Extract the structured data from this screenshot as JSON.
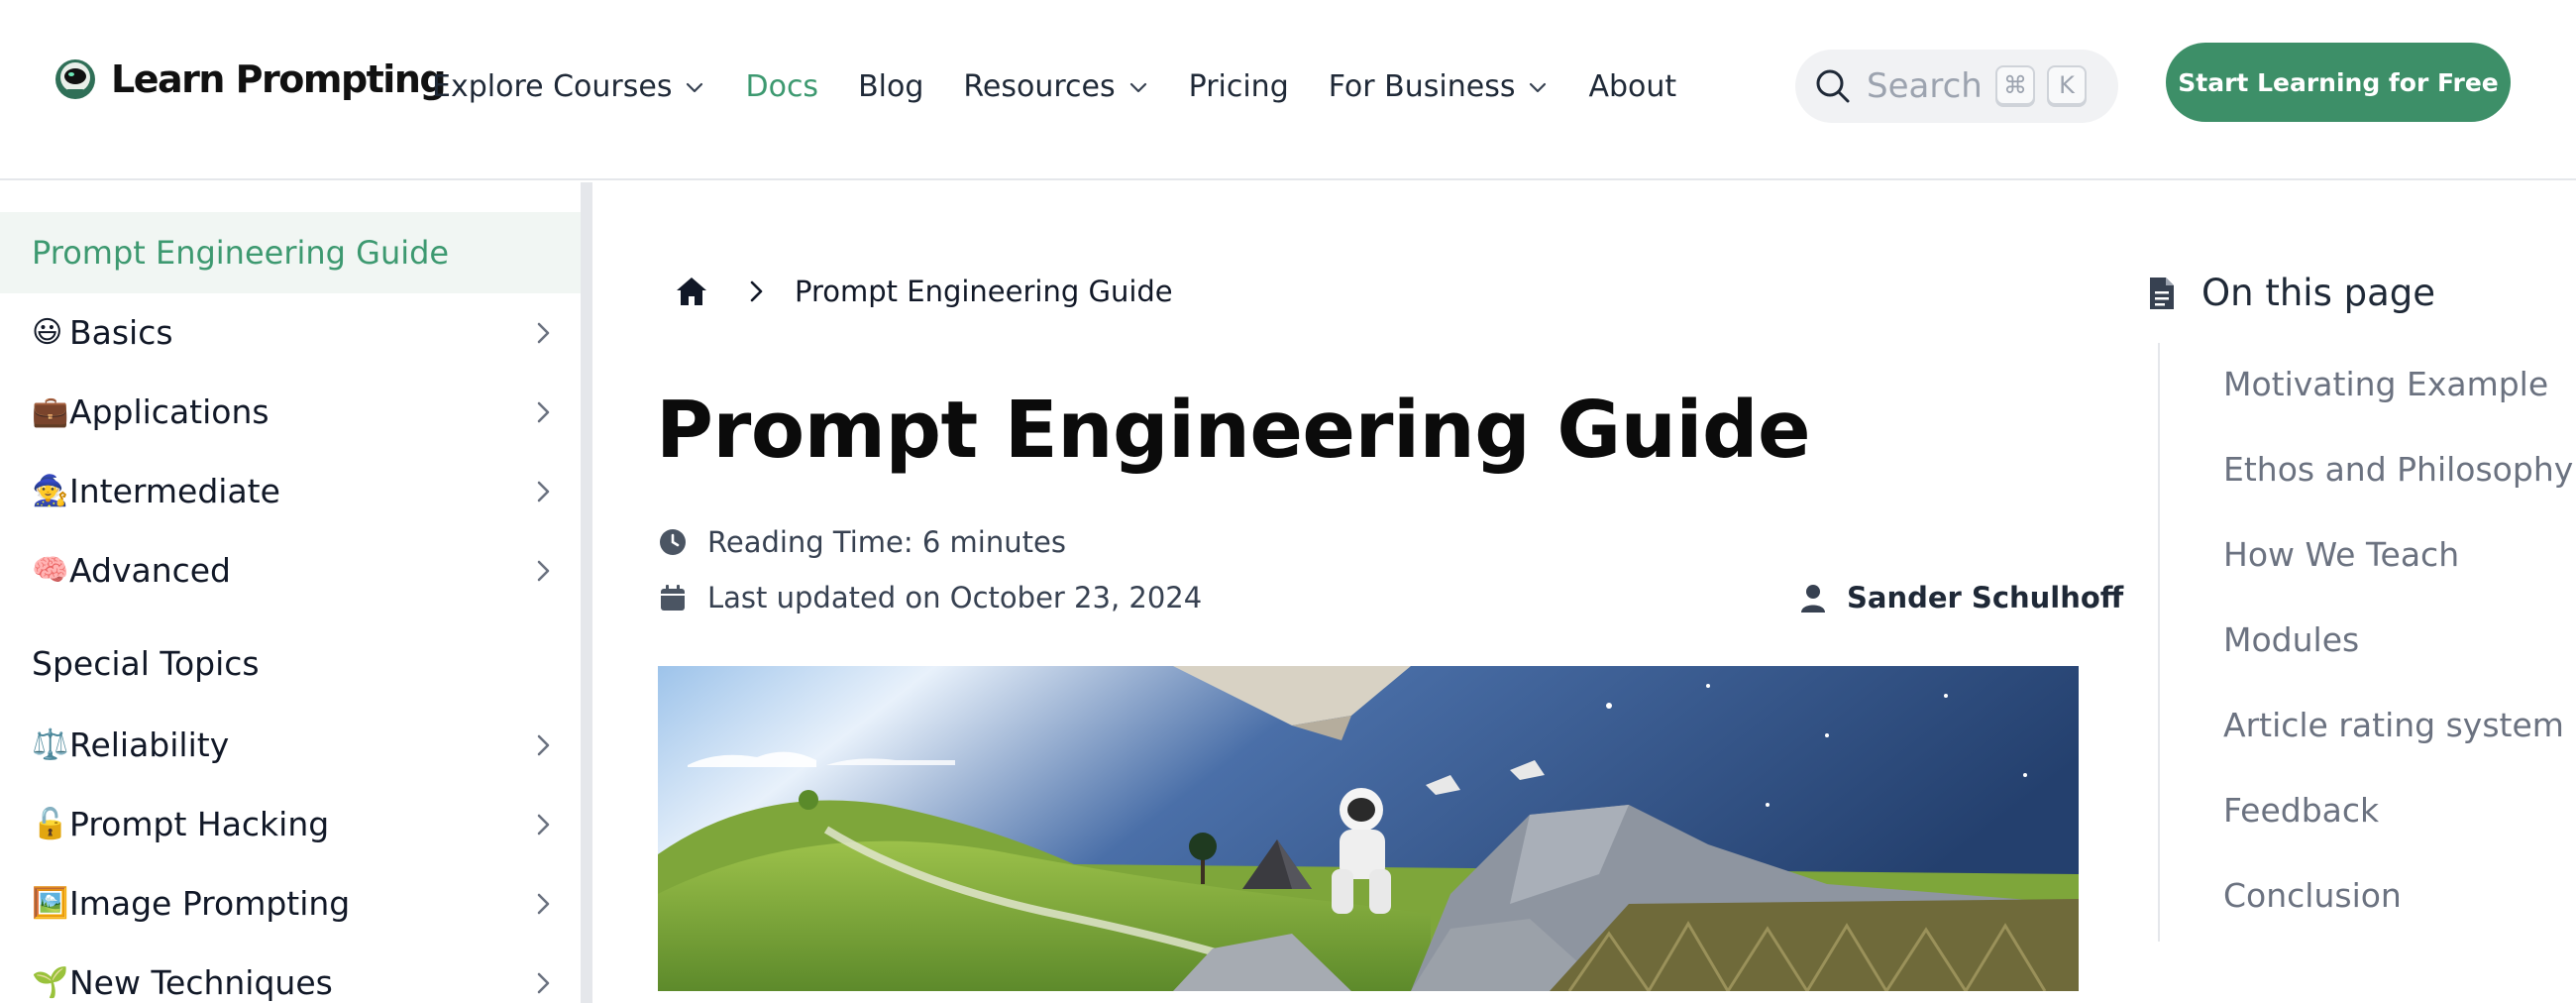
{
  "header": {
    "logo_text": "Learn Prompting",
    "nav": [
      {
        "label": "Explore Courses",
        "dropdown": true
      },
      {
        "label": "Docs",
        "active": true
      },
      {
        "label": "Blog"
      },
      {
        "label": "Resources",
        "dropdown": true
      },
      {
        "label": "Pricing"
      },
      {
        "label": "For Business",
        "dropdown": true
      },
      {
        "label": "About"
      }
    ],
    "search_placeholder": "Search",
    "search_kbd_1": "⌘",
    "search_kbd_2": "K",
    "cta_label": "Start Learning for Free"
  },
  "sidebar": {
    "active_label": "Prompt Engineering Guide",
    "items": [
      {
        "emoji": "😃",
        "label": "Basics"
      },
      {
        "emoji": "💼",
        "label": "Applications"
      },
      {
        "emoji": "🧙",
        "label": "Intermediate"
      },
      {
        "emoji": "🧠",
        "label": "Advanced"
      }
    ],
    "section_heading": "Special Topics",
    "topic_items": [
      {
        "emoji": "⚖️",
        "label": "Reliability"
      },
      {
        "emoji": "🔓",
        "label": "Prompt Hacking"
      },
      {
        "emoji": "🖼️",
        "label": "Image Prompting"
      },
      {
        "emoji": "🌱",
        "label": "New Techniques"
      }
    ]
  },
  "main": {
    "breadcrumb_label": "Prompt Engineering Guide",
    "title": "Prompt Engineering Guide",
    "reading_time": "Reading Time: 6 minutes",
    "last_updated": "Last updated on October 23, 2024",
    "author": "Sander Schulhoff"
  },
  "toc": {
    "title": "On this page",
    "items": [
      "Motivating Example",
      "Ethos and Philosophy",
      "How We Teach",
      "Modules",
      "Article rating system",
      "Feedback",
      "Conclusion"
    ]
  },
  "colors": {
    "accent": "#3d9970",
    "cta": "#3d8f68",
    "text": "#111827",
    "muted": "#6b7280"
  }
}
